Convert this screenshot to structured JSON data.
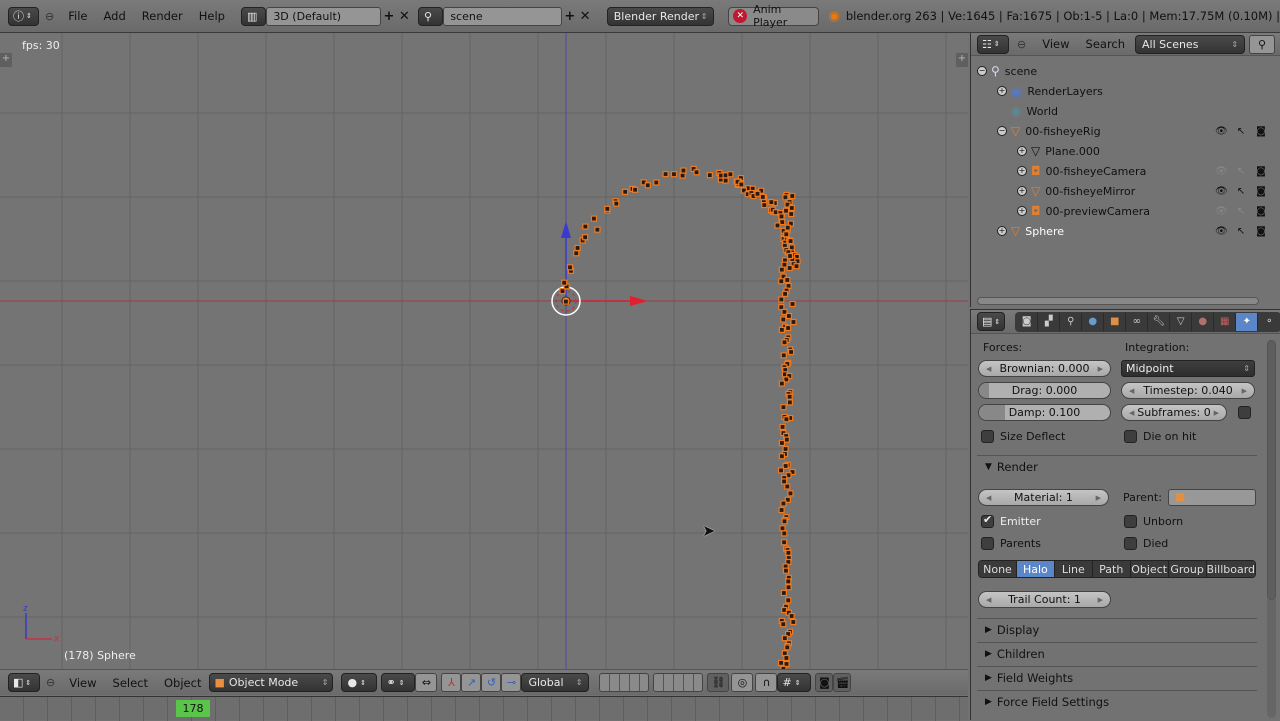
{
  "topbar": {
    "menus": [
      "File",
      "Add",
      "Render",
      "Help"
    ],
    "screen_layout": "3D (Default)",
    "scene": "scene",
    "render_engine": "Blender Render",
    "anim_player": "Anim Player",
    "stats": "blender.org 263 | Ve:1645 | Fa:1675 | Ob:1-5 | La:0 | Mem:17.75M (0.10M) |"
  },
  "viewport": {
    "fps": "fps: 30",
    "object_label": "(178) Sphere",
    "axis_x": "x",
    "axis_z": "z",
    "colors": {
      "x_axis": "#c8304a",
      "z_axis": "#3a3ac8",
      "particle": "#f07a20"
    }
  },
  "viewport_header": {
    "menus": [
      "View",
      "Select",
      "Object"
    ],
    "mode": "Object Mode",
    "orientation": "Global"
  },
  "timeline": {
    "current_frame": "178"
  },
  "outliner": {
    "menus": [
      "View",
      "Search"
    ],
    "filter": "All Scenes",
    "tree": [
      {
        "label": "scene",
        "icon": "scene-icon",
        "depth": 0,
        "expander": "−"
      },
      {
        "label": "RenderLayers",
        "icon": "renderlayers-icon",
        "depth": 1,
        "expander": "+"
      },
      {
        "label": "World",
        "icon": "world-icon",
        "depth": 1,
        "expander": ""
      },
      {
        "label": "00-fisheyeRig",
        "icon": "mesh-object-icon",
        "depth": 1,
        "expander": "−",
        "eye": true
      },
      {
        "label": "Plane.000",
        "icon": "mesh-data-icon",
        "depth": 2,
        "expander": "+"
      },
      {
        "label": "00-fisheyeCamera",
        "icon": "camera-object-icon",
        "depth": 2,
        "expander": "+",
        "eye": false
      },
      {
        "label": "00-fisheyeMirror",
        "icon": "mesh-object-icon",
        "depth": 2,
        "expander": "+",
        "eye": true
      },
      {
        "label": "00-previewCamera",
        "icon": "camera-object-icon",
        "depth": 2,
        "expander": "+",
        "eye": false
      },
      {
        "label": "Sphere",
        "icon": "mesh-object-icon",
        "depth": 1,
        "expander": "+",
        "eye": true,
        "selected": true
      }
    ]
  },
  "properties": {
    "forces_label": "Forces:",
    "integration_label": "Integration:",
    "brownian": "Brownian: 0.000",
    "drag": "Drag: 0.000",
    "damp": "Damp: 0.100",
    "integration": "Midpoint",
    "timestep": "Timestep: 0.040",
    "subframes": "Subframes: 0",
    "size_deflect": "Size Deflect",
    "die_on_hit": "Die on hit",
    "render_panel": "Render",
    "material": "Material: 1",
    "parent_label": "Parent:",
    "emitter": "Emitter",
    "unborn": "Unborn",
    "parents": "Parents",
    "died": "Died",
    "render_types": [
      "None",
      "Halo",
      "Line",
      "Path",
      "Object",
      "Group",
      "Billboard"
    ],
    "render_type_active": "Halo",
    "trail_count": "Trail Count: 1",
    "collapsed_panels": [
      "Display",
      "Children",
      "Field Weights",
      "Force Field Settings"
    ],
    "checks": {
      "size_deflect": false,
      "die_on_hit": false,
      "emitter": true,
      "unborn": false,
      "parents": false,
      "died": false
    },
    "accent": "#5b86c8"
  }
}
